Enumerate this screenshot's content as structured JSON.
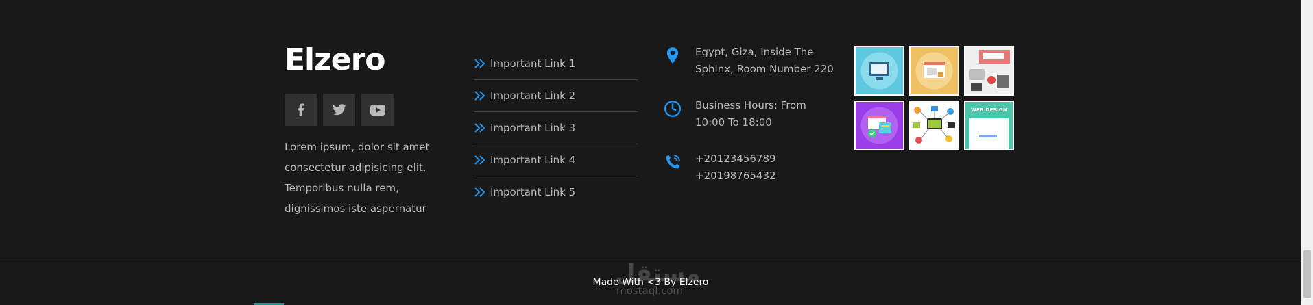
{
  "brand": {
    "name": "Elzero"
  },
  "social": [
    {
      "name": "facebook",
      "icon": "facebook-icon"
    },
    {
      "name": "twitter",
      "icon": "twitter-icon"
    },
    {
      "name": "youtube",
      "icon": "youtube-icon"
    }
  ],
  "about": {
    "text": "Lorem ipsum, dolor sit amet consectetur adipisicing elit. Temporibus nulla rem, dignissimos iste aspernatur"
  },
  "links": [
    {
      "label": "Important Link 1"
    },
    {
      "label": "Important Link 2"
    },
    {
      "label": "Important Link 3"
    },
    {
      "label": "Important Link 4"
    },
    {
      "label": "Important Link 5"
    }
  ],
  "contact": {
    "address": "Egypt, Giza, Inside The Sphinx, Room Number 220",
    "hours": "Business Hours: From 10:00 To 18:00",
    "phone1": "+20123456789",
    "phone2": "+20198765432"
  },
  "gallery": [
    {
      "icon": "computer-icon",
      "color": "#5ec8df"
    },
    {
      "icon": "browser-icon",
      "color": "#efc061"
    },
    {
      "icon": "workspace-icon",
      "color": "#f0f0f0"
    },
    {
      "icon": "design-icon",
      "color": "#9b3de8"
    },
    {
      "icon": "network-icon",
      "color": "#ffffff"
    },
    {
      "icon": "web-design-icon",
      "color": "#4cc5a8"
    }
  ],
  "gallery_caption": "WEB DESIGN",
  "copyright": "Made With <3 By Elzero",
  "watermark": {
    "arabic": "مستقل",
    "latin": "mostaql.com"
  },
  "colors": {
    "accent": "#2196f3",
    "background": "#191919"
  }
}
